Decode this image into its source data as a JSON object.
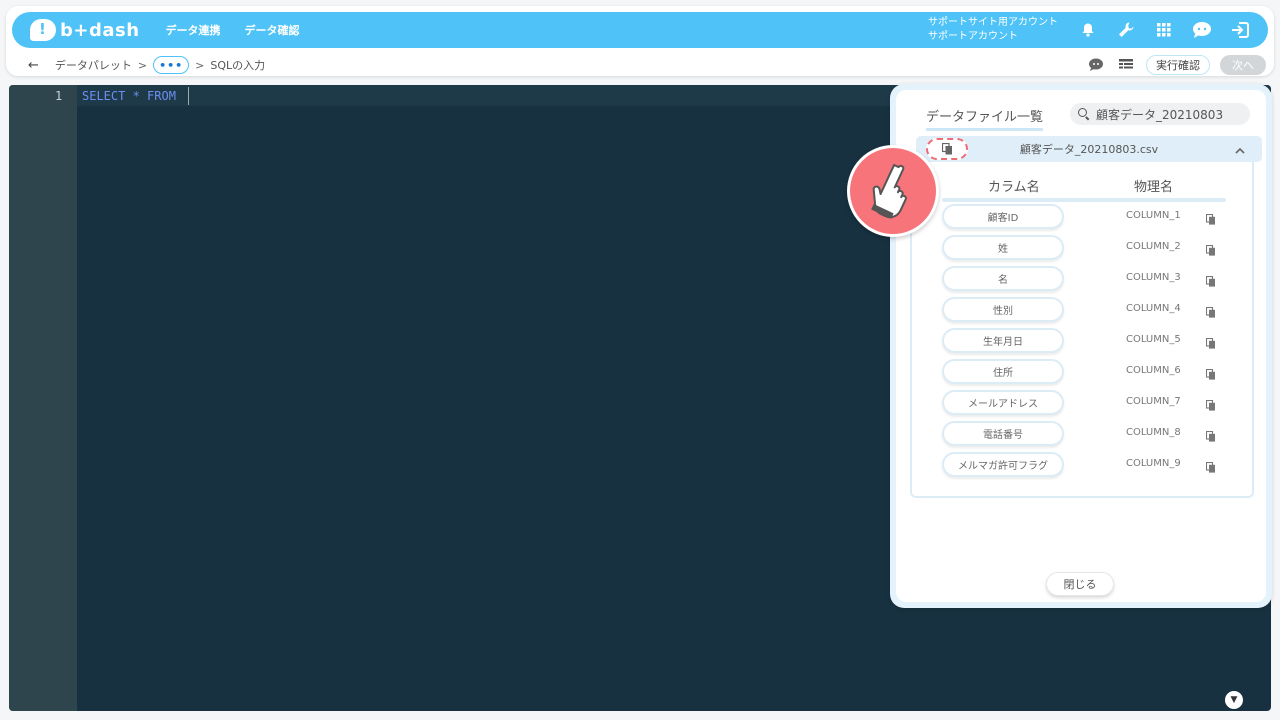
{
  "header": {
    "logo_text": "b+dash",
    "nav": [
      "データ連携",
      "データ確認"
    ],
    "account_line1": "サポートサイト用アカウント",
    "account_line2": "サポートアカウント",
    "icons": [
      "bell-icon",
      "wrench-icon",
      "grid-icon",
      "chat-icon",
      "logout-icon"
    ]
  },
  "subbar": {
    "crumb1": "データパレット",
    "sep": ">",
    "more": "•••",
    "crumb3": "SQLの入力",
    "run_check": "実行確認",
    "next": "次へ"
  },
  "editor": {
    "line_number": "1",
    "code": "SELECT * FROM"
  },
  "panel": {
    "title": "データファイル一覧",
    "search_value": "顧客データ_20210803",
    "file_name": "顧客データ_20210803.csv",
    "col_header_name": "カラム名",
    "col_header_physical": "物理名",
    "columns": [
      {
        "name": "顧客ID",
        "physical": "COLUMN_1"
      },
      {
        "name": "姓",
        "physical": "COLUMN_2"
      },
      {
        "name": "名",
        "physical": "COLUMN_3"
      },
      {
        "name": "性別",
        "physical": "COLUMN_4"
      },
      {
        "name": "生年月日",
        "physical": "COLUMN_5"
      },
      {
        "name": "住所",
        "physical": "COLUMN_6"
      },
      {
        "name": "メールアドレス",
        "physical": "COLUMN_7"
      },
      {
        "name": "電話番号",
        "physical": "COLUMN_8"
      },
      {
        "name": "メルマガ許可フラグ",
        "physical": "COLUMN_9"
      }
    ],
    "close_label": "閉じる"
  },
  "colors": {
    "accent": "#4fc3f7",
    "editor_bg": "#173140",
    "highlight": "#f7747a"
  }
}
